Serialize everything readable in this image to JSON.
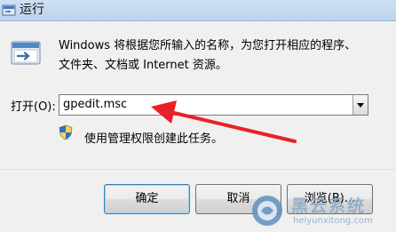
{
  "window": {
    "title": "运行"
  },
  "dialog": {
    "description_line1": "Windows 将根据您所输入的名称，为您打开相应的程序、",
    "description_line2": "文件夹、文档或 Internet 资源。",
    "open_label": "打开(O):",
    "open_value": "gpedit.msc",
    "admin_note": "使用管理权限创建此任务。"
  },
  "buttons": {
    "ok": "确定",
    "cancel": "取消",
    "browse": "浏览(B)..."
  },
  "watermark": {
    "title": "黑云系统",
    "url": "heiyunxitong.com"
  },
  "colors": {
    "annotation_arrow": "#e8202a",
    "titlebar": "#c6dbf1"
  }
}
